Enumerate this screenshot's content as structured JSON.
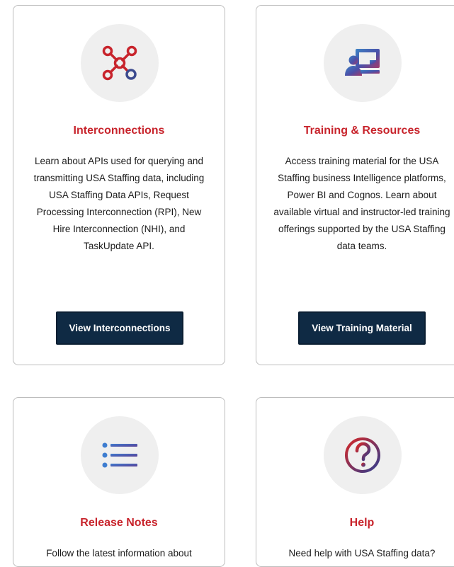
{
  "cards": [
    {
      "icon": "interconnections-network-icon",
      "title": "Interconnections",
      "description": "Learn about APIs used for querying and transmitting USA Staffing data, including USA Staffing Data APIs, Request Processing Interconnection (RPI), New Hire Interconnection (NHI), and TaskUpdate API.",
      "button_label": "View Interconnections"
    },
    {
      "icon": "presentation-training-icon",
      "title": "Training & Resources",
      "description": "Access training material for the USA Staffing business Intelligence platforms, Power BI and Cognos. Learn about available virtual and instructor-led training offerings supported by the USA Staffing data teams.",
      "button_label": "View Training Material"
    },
    {
      "icon": "list-icon",
      "title": "Release Notes",
      "description": "Follow the latest information about"
    },
    {
      "icon": "question-mark-icon",
      "title": "Help",
      "description": "Need help with USA Staffing data?"
    }
  ],
  "colors": {
    "title_red": "#c8242c",
    "button_navy": "#0f2a44",
    "icon_circle_bg": "#efefef",
    "gradient_start": "#d62828",
    "gradient_end": "#2f3d8f"
  }
}
